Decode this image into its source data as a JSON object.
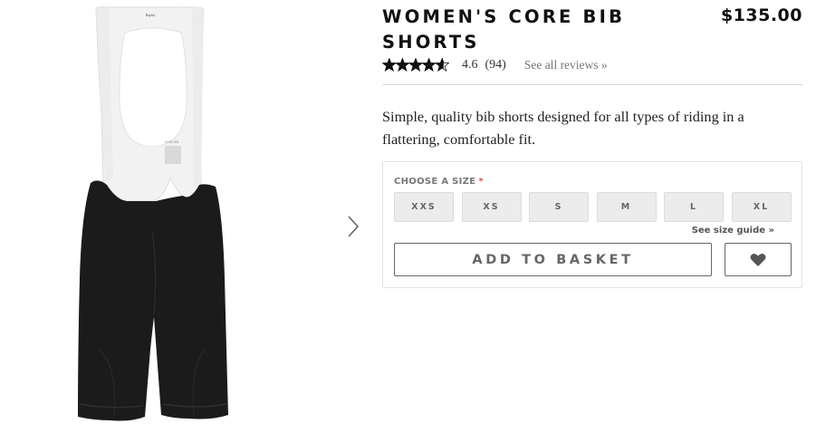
{
  "product": {
    "title": "WOMEN'S CORE BIB SHORTS",
    "price": "$135.00",
    "rating_value": "4.6",
    "review_count": "(94)",
    "reviews_link": "See all reviews »",
    "rating_stars": 4.6,
    "description": "Simple, quality bib shorts designed for all types of riding in a flattering, comfortable fit."
  },
  "image": {
    "brand_mark": "Rapha",
    "next_icon": "chevron-right-icon"
  },
  "size_selector": {
    "label": "CHOOSE A SIZE",
    "required_mark": "*",
    "sizes": [
      "XXS",
      "XS",
      "S",
      "M",
      "L",
      "XL"
    ],
    "size_guide": "See size guide »"
  },
  "actions": {
    "add_to_basket": "ADD TO BASKET",
    "wishlist_icon": "heart-icon"
  },
  "colors": {
    "required": "#d9534f",
    "button_border": "#666666",
    "size_button_bg": "#ececec"
  }
}
